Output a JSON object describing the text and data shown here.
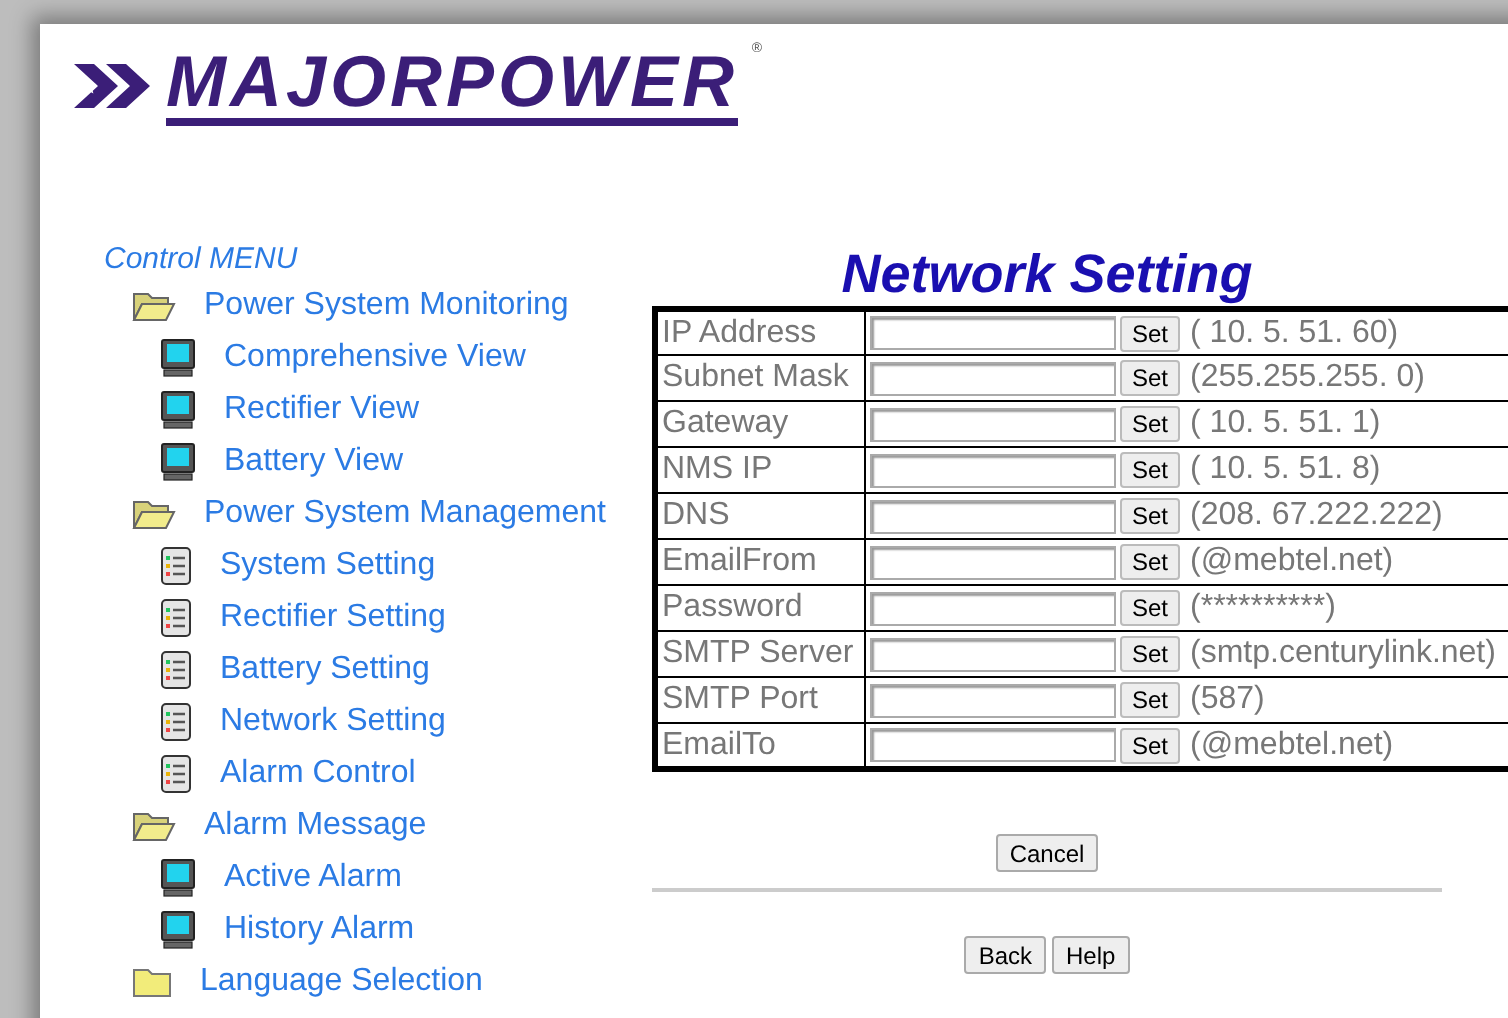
{
  "logo": {
    "text": "MAJORPOWER",
    "mark": "®"
  },
  "menu": {
    "title": "Control MENU",
    "items": [
      {
        "label": "Power System Monitoring",
        "kind": "open",
        "children": [
          {
            "label": "Comprehensive View",
            "kind": "monitor"
          },
          {
            "label": "Rectifier View",
            "kind": "monitor"
          },
          {
            "label": "Battery View",
            "kind": "monitor"
          }
        ]
      },
      {
        "label": "Power System Management",
        "kind": "open",
        "children": [
          {
            "label": "System Setting",
            "kind": "sheet"
          },
          {
            "label": "Rectifier Setting",
            "kind": "sheet"
          },
          {
            "label": "Battery Setting",
            "kind": "sheet"
          },
          {
            "label": "Network Setting",
            "kind": "sheet"
          },
          {
            "label": "Alarm Control",
            "kind": "sheet"
          }
        ]
      },
      {
        "label": "Alarm Message",
        "kind": "open",
        "children": [
          {
            "label": "Active Alarm",
            "kind": "monitor"
          },
          {
            "label": "History Alarm",
            "kind": "monitor"
          }
        ]
      },
      {
        "label": "Language Selection",
        "kind": "closed"
      }
    ]
  },
  "title": "Network Setting",
  "rows": [
    {
      "label": "IP Address",
      "button": "Set",
      "current": "( 10. 5. 51. 60)"
    },
    {
      "label": "Subnet Mask",
      "button": "Set",
      "current": "(255.255.255. 0)"
    },
    {
      "label": "Gateway",
      "button": "Set",
      "current": "( 10. 5. 51. 1)"
    },
    {
      "label": "NMS IP",
      "button": "Set",
      "current": "( 10. 5. 51. 8)"
    },
    {
      "label": "DNS",
      "button": "Set",
      "current": "(208. 67.222.222)"
    },
    {
      "label": "EmailFrom",
      "button": "Set",
      "current": "(@mebtel.net)"
    },
    {
      "label": "Password",
      "button": "Set",
      "current": "(**********)"
    },
    {
      "label": "SMTP Server",
      "button": "Set",
      "current": "(smtp.centurylink.net)"
    },
    {
      "label": "SMTP Port",
      "button": "Set",
      "current": "(587)"
    },
    {
      "label": "EmailTo",
      "button": "Set",
      "current": "(@mebtel.net)"
    }
  ],
  "cancel_button": "Cancel",
  "footer_buttons": [
    "Back",
    "Help"
  ]
}
